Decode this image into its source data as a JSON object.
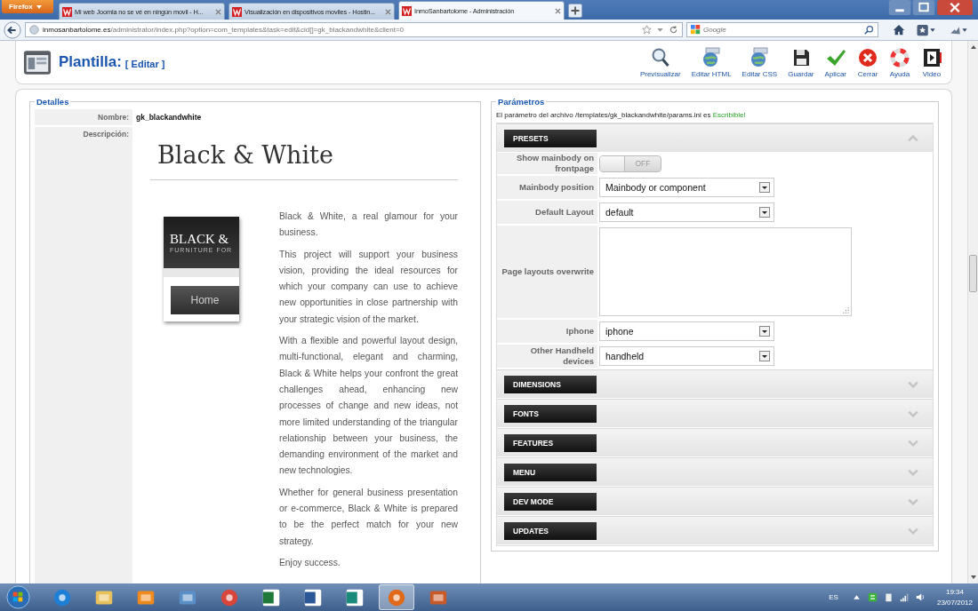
{
  "browser": {
    "menu_button": "Firefox",
    "tabs": [
      {
        "title": "Mi web Joomla no se vé en ningún movil - H...",
        "selected": false
      },
      {
        "title": "Visualización en dispositivos moviles - Hostin...",
        "selected": false
      },
      {
        "title": "InmoSanbartolome - Administración",
        "selected": true
      }
    ],
    "url_host": "inmosanbartolome.es",
    "url_path": "/administrator/index.php?option=com_templates&task=edit&cid[]=gk_blackandwhite&client=0",
    "search_placeholder": "Google"
  },
  "header": {
    "title": "Plantilla:",
    "subtitle": "[ Editar ]",
    "toolbar": [
      {
        "label": "Previsualizar",
        "kind": "preview"
      },
      {
        "label": "Editar HTML",
        "kind": "html"
      },
      {
        "label": "Editar CSS",
        "kind": "css"
      },
      {
        "label": "Guardar",
        "kind": "save"
      },
      {
        "label": "Aplicar",
        "kind": "apply"
      },
      {
        "label": "Cerrar",
        "kind": "close"
      },
      {
        "label": "Ayuda",
        "kind": "help"
      },
      {
        "label": "Video",
        "kind": "video"
      }
    ]
  },
  "details": {
    "legend": "Detalles",
    "name_label": "Nombre:",
    "name_value": "gk_blackandwhite",
    "description_label": "Descripción:",
    "heading": "Black & White",
    "thumb_title": "BLACK &",
    "thumb_subtitle": "FURNITURE FOR",
    "thumb_button": "Home",
    "paragraphs": [
      "Black & White, a real glamour for your business.",
      "This project will support your business vision, providing the ideal resources for which your company can use to achieve new opportunities in close partnership with your strategic vision of the market.",
      "With a flexible and powerful layout design, multi-functional, elegant and charming, Black & White helps your confront the great challenges ahead, enhancing new processes of change and new ideas, not more limited understanding of the triangular relationship between your business, the demanding environment of the market and new technologies.",
      "Whether for general business presentation or e-commerce, Black & White is prepared to be the perfect match for your new strategy.",
      "Enjoy success."
    ]
  },
  "parameters": {
    "legend": "Parámetros",
    "note": "El parámetro del archivo /templates/gk_blackandwhite/params.ini es",
    "status": "Escribible!",
    "sections": [
      {
        "title": "PRESETS",
        "expanded": true,
        "fields": [
          {
            "kind": "toggle",
            "label": "Show mainbody on frontpage",
            "value": "OFF",
            "on": false
          },
          {
            "kind": "select",
            "label": "Mainbody position",
            "value": "Mainbody or component"
          },
          {
            "kind": "select",
            "label": "Default Layout",
            "value": "default"
          },
          {
            "kind": "textarea",
            "label": "Page layouts overwrite"
          },
          {
            "kind": "select",
            "label": "Iphone",
            "value": "iphone"
          },
          {
            "kind": "select",
            "label": "Other Handheld devices",
            "value": "handheld"
          }
        ]
      },
      {
        "title": "DIMENSIONS",
        "expanded": false
      },
      {
        "title": "FONTS",
        "expanded": false
      },
      {
        "title": "FEATURES",
        "expanded": false
      },
      {
        "title": "MENU",
        "expanded": false
      },
      {
        "title": "DEV MODE",
        "expanded": false
      },
      {
        "title": "UPDATES",
        "expanded": false
      }
    ]
  },
  "taskbar": {
    "apps": [
      {
        "kind": "ie",
        "selected": false
      },
      {
        "kind": "folder",
        "selected": false
      },
      {
        "kind": "media",
        "selected": false
      },
      {
        "kind": "photos",
        "selected": false
      },
      {
        "kind": "chrome",
        "selected": false
      },
      {
        "kind": "excel",
        "selected": false
      },
      {
        "kind": "word",
        "selected": false
      },
      {
        "kind": "publisher",
        "selected": false
      },
      {
        "kind": "firefox",
        "selected": true
      },
      {
        "kind": "tool",
        "selected": false
      }
    ],
    "language": "ES",
    "time": "19:34",
    "date": "23/07/2012"
  }
}
